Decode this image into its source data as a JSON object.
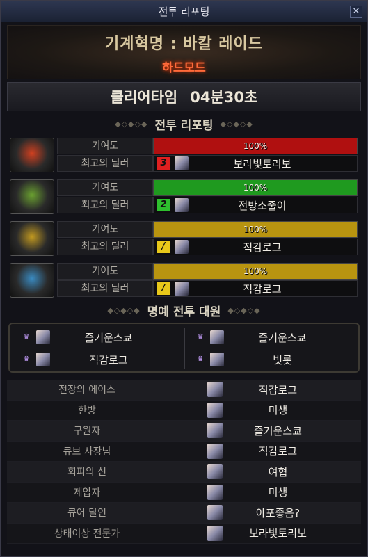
{
  "window": {
    "title": "전투 리포팅",
    "close_glyph": "✕"
  },
  "header": {
    "dungeon": "기계혁명 : 바칼 레이드",
    "mode": "하드모드"
  },
  "clear_time": {
    "label": "클리어타임",
    "value": "04분30초"
  },
  "section_reporting": {
    "title": "전투 리포팅",
    "orn_left": "◆◇◆◇◆",
    "orn_right": "◆◇◆◇◆"
  },
  "parties": [
    {
      "emblem_color": "#d04020",
      "contribution_label": "기여도",
      "contribution": "100%",
      "fill_percent": 100,
      "bar_color": "#b01010",
      "dealer_label": "최고의 딜러",
      "rank": "3",
      "rank_color": "#e02020",
      "dealer_name": "보라빛토리보"
    },
    {
      "emblem_color": "#6aa030",
      "contribution_label": "기여도",
      "contribution": "100%",
      "fill_percent": 100,
      "bar_color": "#1f9a1f",
      "dealer_label": "최고의 딜러",
      "rank": "2",
      "rank_color": "#2ec02e",
      "dealer_name": "전방소줄이"
    },
    {
      "emblem_color": "#c09820",
      "contribution_label": "기여도",
      "contribution": "100%",
      "fill_percent": 100,
      "bar_color": "#b89410",
      "dealer_label": "최고의 딜러",
      "rank": "/",
      "rank_color": "#e8c81a",
      "dealer_name": "직감로그"
    },
    {
      "emblem_color": "#3a8ac0",
      "contribution_label": "기여도",
      "contribution": "100%",
      "fill_percent": 100,
      "bar_color": "#b89410",
      "dealer_label": "최고의 딜러",
      "rank": "/",
      "rank_color": "#e8c81a",
      "dealer_name": "직감로그"
    }
  ],
  "section_honor": {
    "title": "명예 전투 대원",
    "orn_left": "◆◇◆◇◆",
    "orn_right": "◆◇◆◇◆"
  },
  "honor_members": [
    "즐거운스쿄",
    "즐거운스쿄",
    "직감로그",
    "빗롯"
  ],
  "awards": [
    {
      "title": "전장의 에이스",
      "name": "직감로그"
    },
    {
      "title": "한방",
      "name": "미생"
    },
    {
      "title": "구원자",
      "name": "즐거운스쿄"
    },
    {
      "title": "큐브 사장님",
      "name": "직감로그"
    },
    {
      "title": "회피의 신",
      "name": "여협"
    },
    {
      "title": "제압자",
      "name": "미생"
    },
    {
      "title": "큐어 달인",
      "name": "아포좋음?"
    },
    {
      "title": "상태이상 전문가",
      "name": "보라빛토리보"
    }
  ]
}
